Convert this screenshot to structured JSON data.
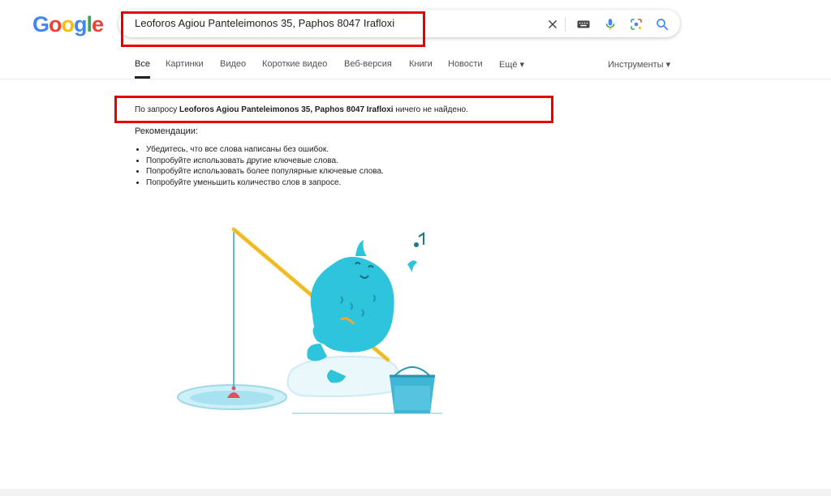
{
  "logo": {
    "letters": [
      "G",
      "o",
      "o",
      "g",
      "l",
      "e"
    ],
    "colors": [
      "#4285F4",
      "#EA4335",
      "#FBBC05",
      "#4285F4",
      "#34A853",
      "#EA4335"
    ]
  },
  "search": {
    "query": "Leoforos Agiou Panteleimonos 35, Paphos 8047 Irafloxi"
  },
  "tabs": [
    {
      "label": "Все",
      "active": true
    },
    {
      "label": "Картинки"
    },
    {
      "label": "Видео"
    },
    {
      "label": "Короткие видео"
    },
    {
      "label": "Веб-версия"
    },
    {
      "label": "Книги"
    },
    {
      "label": "Новости"
    },
    {
      "label": "Ещё ▾"
    }
  ],
  "tools_label": "Инструменты ▾",
  "noresult": {
    "prefix": "По запросу ",
    "query": "Leoforos Agiou Panteleimonos 35, Paphos 8047 Irafloxi",
    "suffix": " ничего не найдено."
  },
  "recommendations": {
    "title": "Рекомендации:",
    "items": [
      "Убедитесь, что все слова написаны без ошибок.",
      "Попробуйте использовать другие ключевые слова.",
      "Попробуйте использовать более популярные ключевые слова.",
      "Попробуйте уменьшить количество слов в запросе."
    ]
  },
  "colors": {
    "highlight": "#e60000",
    "creature": "#2ec4dc",
    "rod": "#f2c230",
    "ice": "#cdeff7"
  },
  "icons": [
    "clear-icon",
    "keyboard-icon",
    "mic-icon",
    "lens-icon",
    "search-icon"
  ]
}
